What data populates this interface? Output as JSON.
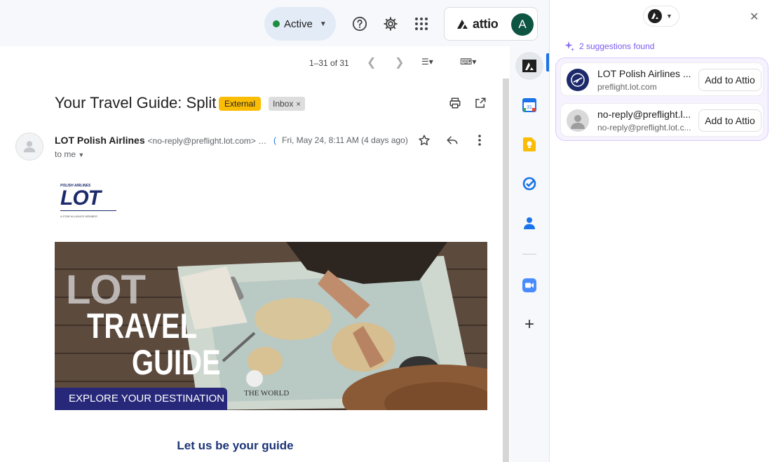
{
  "topbar": {
    "status_label": "Active",
    "attio_label": "attio",
    "avatar_letter": "A"
  },
  "toolbar": {
    "pager_text": "1–31 of 31"
  },
  "email": {
    "subject": "Your Travel Guide: Split",
    "tag_external": "External",
    "tag_inbox": "Inbox",
    "sender_name": "LOT Polish Airlines",
    "sender_email": "<no-reply@preflight.lot.com> …",
    "date": "Fri, May 24, 8:11 AM (4 days ago)",
    "recipient": "to me",
    "logo": {
      "top": "POLISH AIRLINES",
      "main": "LOT",
      "bottom": "A STAR ALLIANCE MEMBER"
    },
    "banner": {
      "line1": "LOT",
      "line2": "TRAVEL",
      "line3": "GUIDE",
      "cta": "EXPLORE YOUR DESTINATION",
      "book_label": "THE WORLD"
    },
    "section_heading": "Let us be your guide"
  },
  "panel": {
    "suggestions_count_text": "2 suggestions found",
    "suggestions": [
      {
        "name": "LOT Polish Airlines ...",
        "domain": "preflight.lot.com",
        "button": "Add to Attio"
      },
      {
        "name": "no-reply@preflight.l...",
        "domain": "no-reply@preflight.lot.c...",
        "button": "Add to Attio"
      }
    ]
  },
  "colors": {
    "accent_blue": "#1a73e8",
    "status_green": "#1e8e3e",
    "external_tag": "#fbbc04",
    "attio_purple": "#7b5cf0",
    "lot_navy": "#1c2a6b"
  }
}
